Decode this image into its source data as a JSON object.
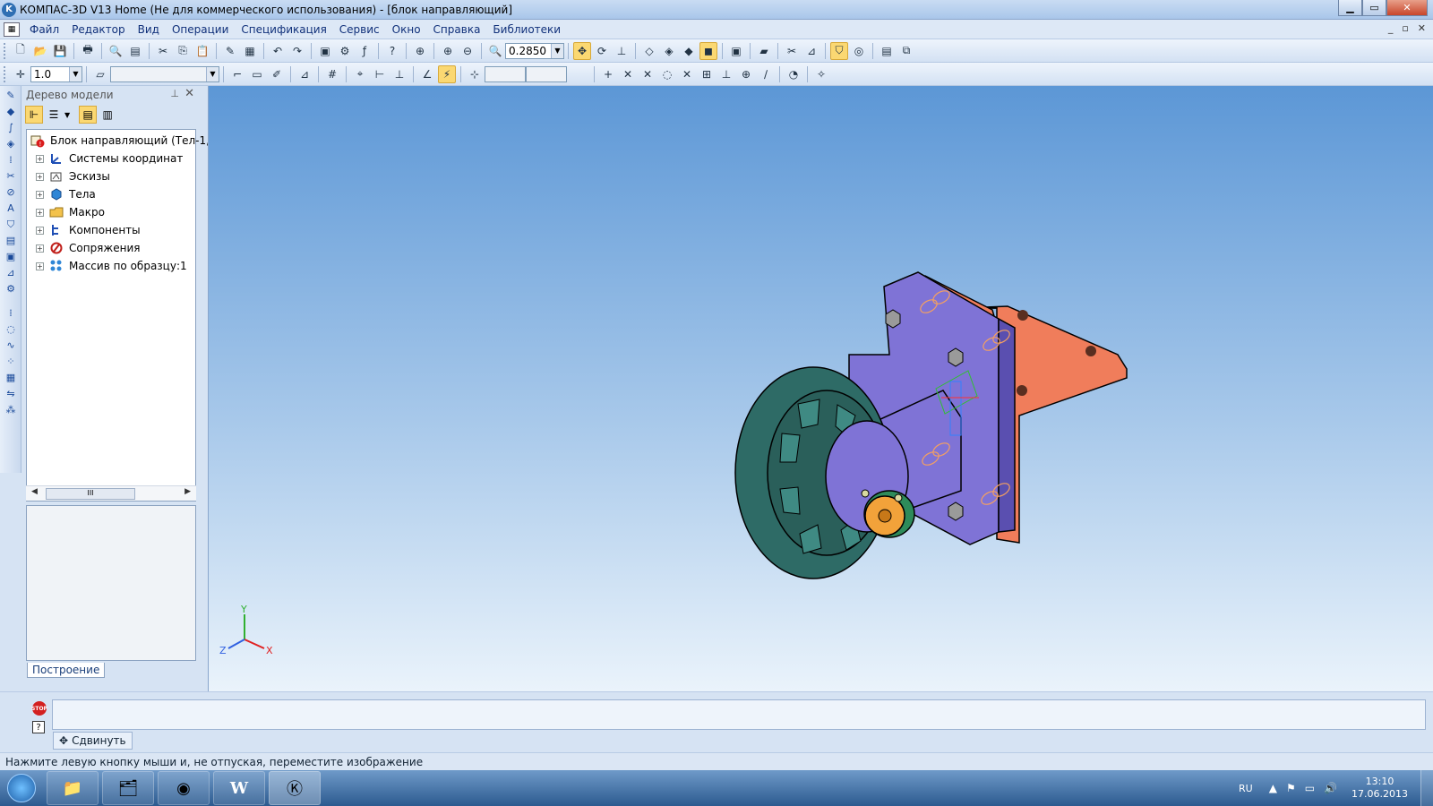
{
  "window": {
    "title": "КОМПАС-3D V13 Home (Не для коммерческого использования) - [блок направляющий]",
    "minimize": "▁",
    "maximize": "▭",
    "close": "✕"
  },
  "menu": [
    "Файл",
    "Редактор",
    "Вид",
    "Операции",
    "Спецификация",
    "Сервис",
    "Окно",
    "Справка",
    "Библиотеки"
  ],
  "mdi_buttons": [
    "_",
    "▫",
    "✕"
  ],
  "toolbar": {
    "zoom_value": "0.2850",
    "line_scale": "1.0"
  },
  "tree": {
    "header": "Дерево модели",
    "pin": "📌",
    "close": "✕",
    "root": "Блок направляющий (Тел-1,",
    "items": [
      {
        "label": "Системы координат",
        "icon": "coordinate-systems-icon"
      },
      {
        "label": "Эскизы",
        "icon": "sketches-icon"
      },
      {
        "label": "Тела",
        "icon": "bodies-icon"
      },
      {
        "label": "Макро",
        "icon": "macro-icon"
      },
      {
        "label": "Компоненты",
        "icon": "components-icon"
      },
      {
        "label": "Сопряжения",
        "icon": "mates-icon"
      },
      {
        "label": "Массив по образцу:1",
        "icon": "pattern-icon"
      }
    ],
    "scroll_thumb": "III",
    "tab": "Построение"
  },
  "axes": {
    "x": "X",
    "y": "Y",
    "z": "Z"
  },
  "command": {
    "stop": "STOP",
    "help": "?",
    "tab_label": "Сдвинуть"
  },
  "status": "Нажмите левую кнопку мыши и, не отпуская, переместите изображение",
  "taskbar": {
    "lang": "RU",
    "time": "13:10",
    "date": "17.06.2013"
  },
  "colors": {
    "plate_purple": "#7f73d6",
    "bracket_orange": "#f07d5b",
    "wheel_teal": "#2e6b66",
    "hub_orange": "#f2a23a"
  }
}
